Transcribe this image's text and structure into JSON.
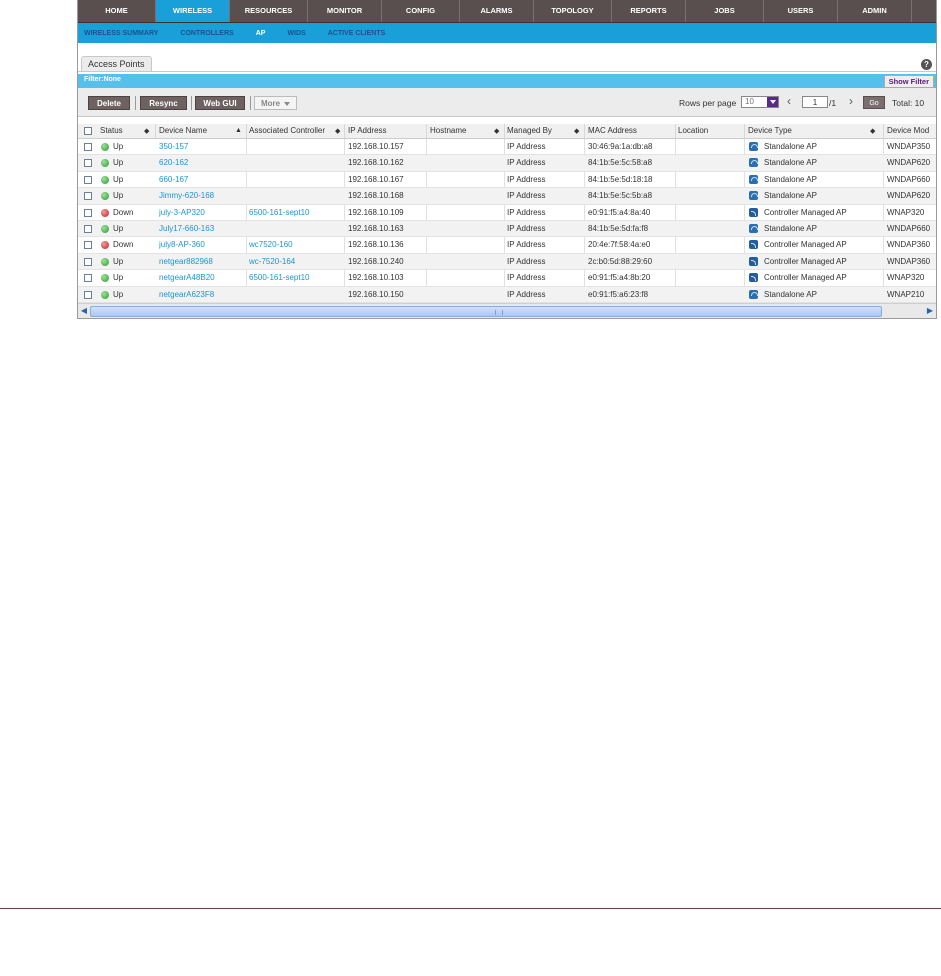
{
  "topnav": [
    "HOME",
    "WIRELESS",
    "RESOURCES",
    "MONITOR",
    "CONFIG",
    "ALARMS",
    "TOPOLOGY",
    "REPORTS",
    "JOBS",
    "USERS",
    "ADMIN"
  ],
  "topnav_active": "WIRELESS",
  "subnav": [
    "WIRELESS SUMMARY",
    "CONTROLLERS",
    "AP",
    "WIDS",
    "ACTIVE CLIENTS"
  ],
  "subnav_active": "AP",
  "tab_label": "Access Points",
  "help_icon": "?",
  "filter": {
    "label": "Filter:None",
    "button": "Show Filter"
  },
  "toolbar": {
    "delete": "Delete",
    "resync": "Resync",
    "webgui": "Web GUI",
    "more": "More",
    "rows_per_page_label": "Rows per page",
    "rows_per_page_value": "10",
    "page_value": "1",
    "page_total": "/1",
    "go": "Go",
    "total": "Total: 10"
  },
  "columns": [
    "Status",
    "Device Name",
    "Associated Controller",
    "IP Address",
    "Hostname",
    "Managed By",
    "MAC Address",
    "Location",
    "Device Type",
    "Device Mod"
  ],
  "rows": [
    {
      "status": "Up",
      "status_key": "up",
      "name": "350-157",
      "controller": "",
      "ip": "192.168.10.157",
      "hostname": "",
      "managed": "IP Address",
      "mac": "30:46:9a:1a:db:a8",
      "location": "",
      "type": "Standalone AP",
      "type_key": "sa",
      "model": "WNDAP350"
    },
    {
      "status": "Up",
      "status_key": "up",
      "name": "620-162",
      "controller": "",
      "ip": "192.168.10.162",
      "hostname": "",
      "managed": "IP Address",
      "mac": "84:1b:5e:5c:58:a8",
      "location": "",
      "type": "Standalone AP",
      "type_key": "sa",
      "model": "WNDAP620"
    },
    {
      "status": "Up",
      "status_key": "up",
      "name": "660-167",
      "controller": "",
      "ip": "192.168.10.167",
      "hostname": "",
      "managed": "IP Address",
      "mac": "84:1b:5e:5d:18:18",
      "location": "",
      "type": "Standalone AP",
      "type_key": "sa",
      "model": "WNDAP660"
    },
    {
      "status": "Up",
      "status_key": "up",
      "name": "Jimmy-620-168",
      "controller": "",
      "ip": "192.168.10.168",
      "hostname": "",
      "managed": "IP Address",
      "mac": "84:1b:5e:5c:5b:a8",
      "location": "",
      "type": "Standalone AP",
      "type_key": "sa",
      "model": "WNDAP620"
    },
    {
      "status": "Down",
      "status_key": "down",
      "name": "july-3-AP320",
      "controller": "6500-161-sept10",
      "ip": "192.168.10.109",
      "hostname": "",
      "managed": "IP Address",
      "mac": "e0:91:f5:a4:8a:40",
      "location": "",
      "type": "Controller Managed AP",
      "type_key": "cm",
      "model": "WNAP320"
    },
    {
      "status": "Up",
      "status_key": "up",
      "name": "July17-660-163",
      "controller": "",
      "ip": "192.168.10.163",
      "hostname": "",
      "managed": "IP Address",
      "mac": "84:1b:5e:5d:fa:f8",
      "location": "",
      "type": "Standalone AP",
      "type_key": "sa",
      "model": "WNDAP660"
    },
    {
      "status": "Down",
      "status_key": "down",
      "name": "july8-AP-360",
      "controller": "wc7520-160",
      "ip": "192.168.10.136",
      "hostname": "",
      "managed": "IP Address",
      "mac": "20:4e:7f:58:4a:e0",
      "location": "",
      "type": "Controller Managed AP",
      "type_key": "cm",
      "model": "WNDAP360"
    },
    {
      "status": "Up",
      "status_key": "up",
      "name": "netgear882968",
      "controller": "wc-7520-164",
      "ip": "192.168.10.240",
      "hostname": "",
      "managed": "IP Address",
      "mac": "2c:b0:5d:88:29:60",
      "location": "",
      "type": "Controller Managed AP",
      "type_key": "cm",
      "model": "WNDAP360"
    },
    {
      "status": "Up",
      "status_key": "up",
      "name": "netgearA48B20",
      "controller": "6500-161-sept10",
      "ip": "192.168.10.103",
      "hostname": "",
      "managed": "IP Address",
      "mac": "e0:91:f5:a4:8b:20",
      "location": "",
      "type": "Controller Managed AP",
      "type_key": "cm",
      "model": "WNAP320"
    },
    {
      "status": "Up",
      "status_key": "up",
      "name": "netgearA623F8",
      "controller": "",
      "ip": "192.168.10.150",
      "hostname": "",
      "managed": "IP Address",
      "mac": "e0:91:f5:a6:23:f8",
      "location": "",
      "type": "Standalone AP",
      "type_key": "sa",
      "model": "WNAP210"
    }
  ],
  "scroll_arrows": {
    "left": "◀",
    "right": "▶"
  }
}
